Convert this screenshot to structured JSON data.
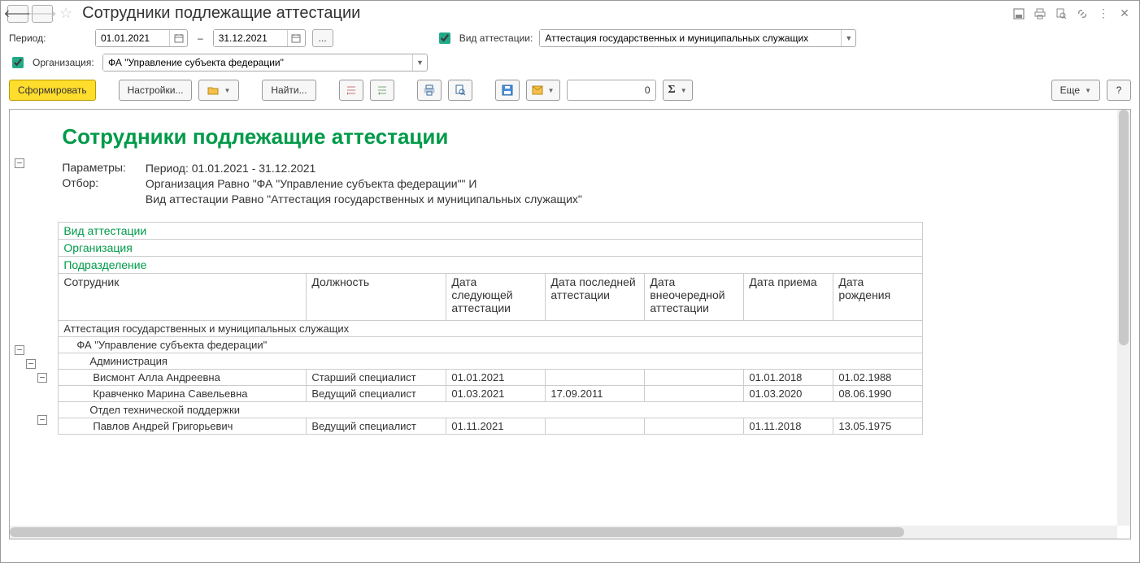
{
  "title": "Сотрудники подлежащие аттестации",
  "filters": {
    "period_label": "Период:",
    "date_from": "01.01.2021",
    "date_to": "31.12.2021",
    "dash": "–",
    "type_label": "Вид аттестации:",
    "type_value": "Аттестация государственных и муниципальных служащих",
    "org_label": "Организация:",
    "org_value": "ФА \"Управление субъекта федерации\""
  },
  "toolbar": {
    "generate": "Сформировать",
    "settings": "Настройки...",
    "find": "Найти...",
    "sum_value": "0",
    "more": "Еще",
    "help": "?"
  },
  "report": {
    "title": "Сотрудники подлежащие аттестации",
    "params_label": "Параметры:",
    "params_value": "Период: 01.01.2021 - 31.12.2021",
    "filter_label": "Отбор:",
    "filter_line1": "Организация Равно \"ФА \"Управление субъекта федерации\"\" И",
    "filter_line2": "Вид аттестации Равно \"Аттестация государственных и муниципальных служащих\"",
    "group_headers": {
      "type": "Вид аттестации",
      "org": "Организация",
      "dept": "Подразделение"
    },
    "columns": {
      "employee": "Сотрудник",
      "position": "Должность",
      "next": "Дата следующей аттестации",
      "last": "Дата последней аттестации",
      "extra": "Дата внеочередной аттестации",
      "hire": "Дата приема",
      "birth": "Дата рождения"
    },
    "data": {
      "type": "Аттестация государственных и муниципальных служащих",
      "org": "ФА \"Управление субъекта федерации\"",
      "depts": [
        {
          "name": "Администрация",
          "rows": [
            {
              "emp": "Висмонт Алла Андреевна",
              "pos": "Старший специалист",
              "next": "01.01.2021",
              "last": "",
              "extra": "",
              "hire": "01.01.2018",
              "birth": "01.02.1988"
            },
            {
              "emp": "Кравченко Марина Савельевна",
              "pos": "Ведущий специалист",
              "next": "01.03.2021",
              "last": "17.09.2011",
              "extra": "",
              "hire": "01.03.2020",
              "birth": "08.06.1990"
            }
          ]
        },
        {
          "name": "Отдел технической поддержки",
          "rows": [
            {
              "emp": "Павлов Андрей Григорьевич",
              "pos": "Ведущий специалист",
              "next": "01.11.2021",
              "last": "",
              "extra": "",
              "hire": "01.11.2018",
              "birth": "13.05.1975"
            }
          ]
        }
      ]
    }
  }
}
